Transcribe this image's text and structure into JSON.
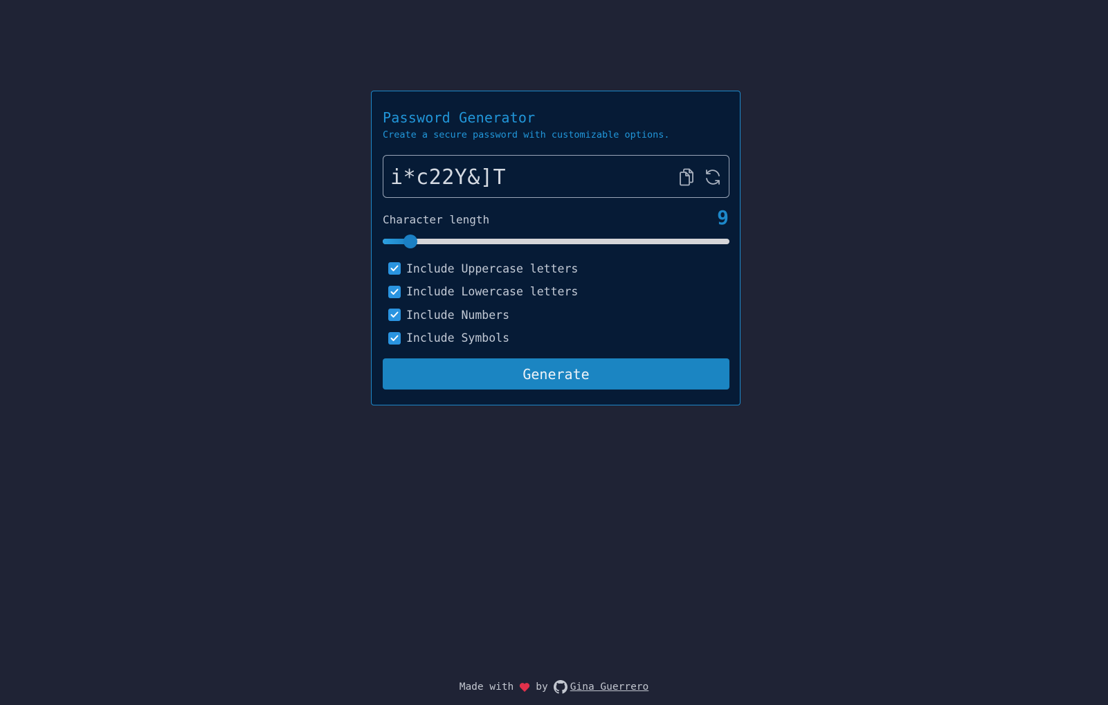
{
  "card": {
    "title": "Password Generator",
    "subtitle": "Create a secure password with customizable options."
  },
  "password": {
    "value": "i*c22Y&]T",
    "copy_icon": "copy-icon",
    "refresh_icon": "refresh-icon"
  },
  "length": {
    "label": "Character length",
    "value": "9",
    "slider_fraction": 0.08
  },
  "options": [
    {
      "label": "Include Uppercase letters",
      "checked": true
    },
    {
      "label": "Include Lowercase letters",
      "checked": true
    },
    {
      "label": "Include Numbers",
      "checked": true
    },
    {
      "label": "Include Symbols",
      "checked": true
    }
  ],
  "generate_label": "Generate",
  "footer": {
    "made_with": "Made with",
    "by": "by",
    "author": "Gina Guerrero"
  },
  "colors": {
    "background": "#1f2335",
    "card": "#061b36",
    "accent": "#1d88c9"
  }
}
